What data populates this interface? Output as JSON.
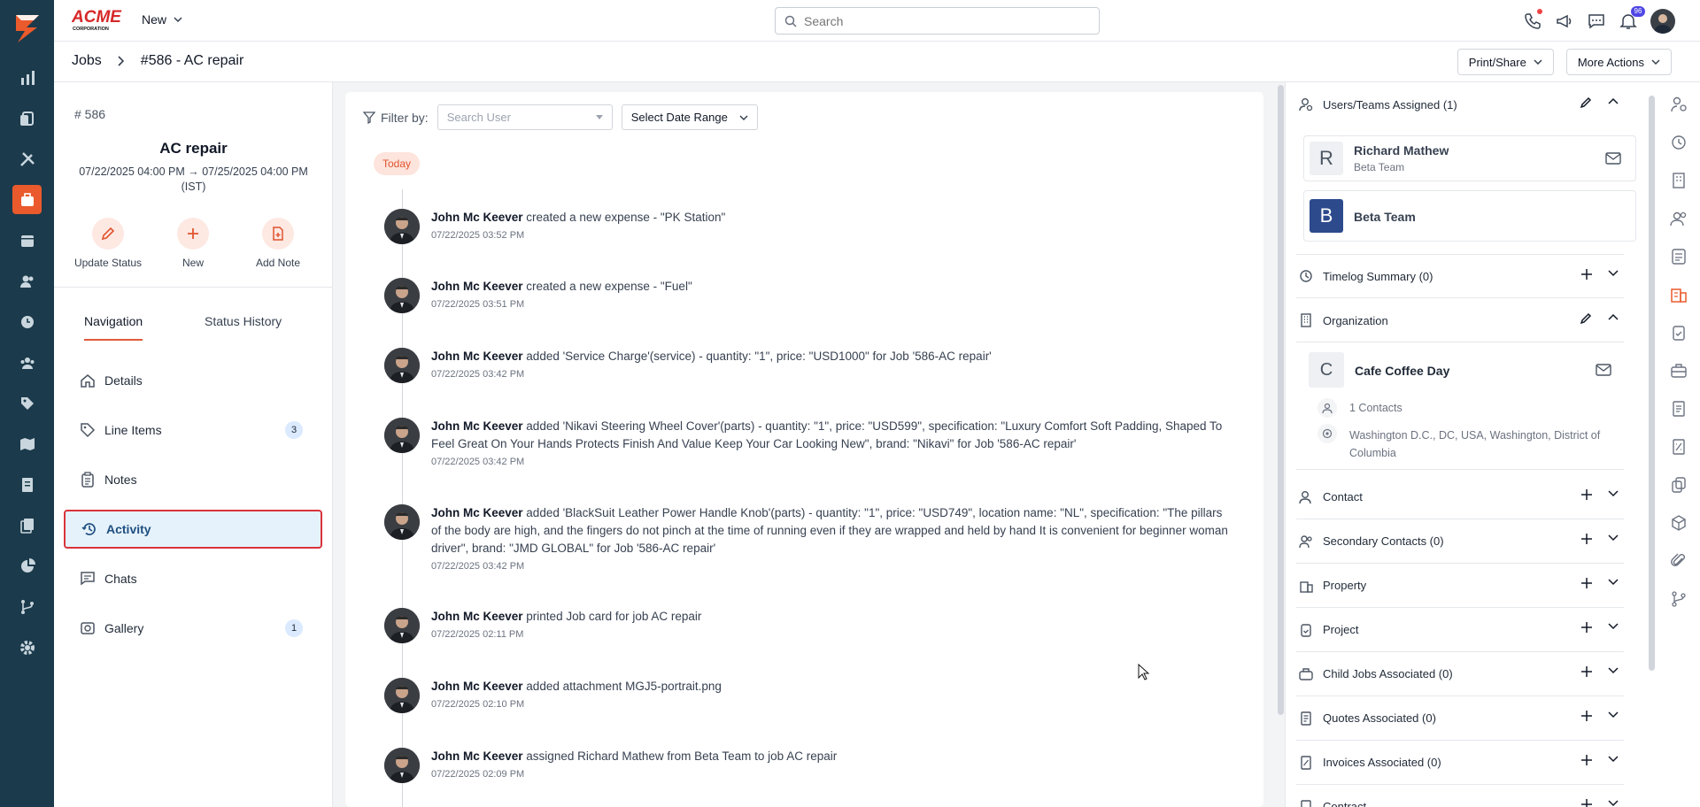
{
  "app": {
    "brand_top": "ACME",
    "brand_bottom": "CORPORATION",
    "new_label": "New",
    "search_placeholder": "Search",
    "notifications_count": "96"
  },
  "breadcrumb": {
    "root": "Jobs",
    "current": "#586 - AC repair"
  },
  "actions": {
    "print_share": "Print/Share",
    "more_actions": "More Actions"
  },
  "job": {
    "number": "# 586",
    "title": "AC repair",
    "dates": "07/22/2025 04:00 PM → 07/25/2025 04:00 PM (IST)"
  },
  "quick_actions": [
    {
      "label": "Update Status",
      "icon": "pencil-icon"
    },
    {
      "label": "New",
      "icon": "plus-icon"
    },
    {
      "label": "Add Note",
      "icon": "note-add-icon"
    }
  ],
  "tabs": {
    "navigation": "Navigation",
    "status_history": "Status History"
  },
  "nav": [
    {
      "label": "Details",
      "icon": "home-icon",
      "count": ""
    },
    {
      "label": "Line Items",
      "icon": "tag-icon",
      "count": "3"
    },
    {
      "label": "Notes",
      "icon": "clipboard-icon",
      "count": ""
    },
    {
      "label": "Activity",
      "icon": "history-icon",
      "count": "",
      "active": true
    },
    {
      "label": "Chats",
      "icon": "chat-icon",
      "count": ""
    },
    {
      "label": "Gallery",
      "icon": "gallery-icon",
      "count": "1"
    }
  ],
  "filter": {
    "label": "Filter by:",
    "user_placeholder": "Search User",
    "date_range": "Select Date Range"
  },
  "day_label": "Today",
  "activities": [
    {
      "user": "John Mc Keever",
      "text": " created a new expense - \"PK Station\"",
      "time": "07/22/2025 03:52 PM"
    },
    {
      "user": "John Mc Keever",
      "text": " created a new expense - \"Fuel\"",
      "time": "07/22/2025 03:51 PM"
    },
    {
      "user": "John Mc Keever",
      "text": " added 'Service Charge'(service) - quantity: \"1\", price: \"USD1000\" for Job '586-AC repair'",
      "time": "07/22/2025 03:42 PM"
    },
    {
      "user": "John Mc Keever",
      "text": " added 'Nikavi Steering Wheel Cover'(parts) - quantity: \"1\", price: \"USD599\", specification: \"Luxury Comfort Soft Padding, Shaped To Feel Great On Your Hands Protects Finish And Value Keep Your Car Looking New\", brand: \"Nikavi\" for Job '586-AC repair'",
      "time": "07/22/2025 03:42 PM"
    },
    {
      "user": "John Mc Keever",
      "text": " added 'BlackSuit Leather Power Handle Knob'(parts) - quantity: \"1\", price: \"USD749\", location name: \"NL\", specification: \"The pillars of the body are high, and the fingers do not pinch at the time of running even if they are wrapped and held by hand It is convenient for beginner woman driver\", brand: \"JMD GLOBAL\" for Job '586-AC repair'",
      "time": "07/22/2025 03:42 PM"
    },
    {
      "user": "John Mc Keever",
      "text": " printed Job card for job AC repair",
      "time": "07/22/2025 02:11 PM"
    },
    {
      "user": "John Mc Keever",
      "text": " added attachment MGJ5-portrait.png",
      "time": "07/22/2025 02:10 PM"
    },
    {
      "user": "John Mc Keever",
      "text": " assigned Richard Mathew from Beta Team to job AC repair",
      "time": "07/22/2025 02:09 PM"
    }
  ],
  "right": {
    "users_title": "Users/Teams Assigned (1)",
    "user_letter": "R",
    "user_name": "Richard Mathew",
    "user_team": "Beta Team",
    "team_letter": "B",
    "team_name": "Beta Team",
    "timelog": "Timelog Summary (0)",
    "organization": "Organization",
    "org_letter": "C",
    "org_name": "Cafe Coffee Day",
    "org_contacts": "1 Contacts",
    "org_address": "Washington D.C., DC, USA, Washington, District of Columbia",
    "sections": [
      "Contact",
      "Secondary Contacts (0)",
      "Property",
      "Project",
      "Child Jobs Associated (0)",
      "Quotes Associated (0)",
      "Invoices Associated (0)",
      "Contract"
    ]
  },
  "colors": {
    "sidebar": "#1b3a4b",
    "accent": "#ea5a2c",
    "active_nav_bg": "#e6f2fb",
    "active_outline": "#d9343b",
    "badge": "#4f46e5"
  }
}
